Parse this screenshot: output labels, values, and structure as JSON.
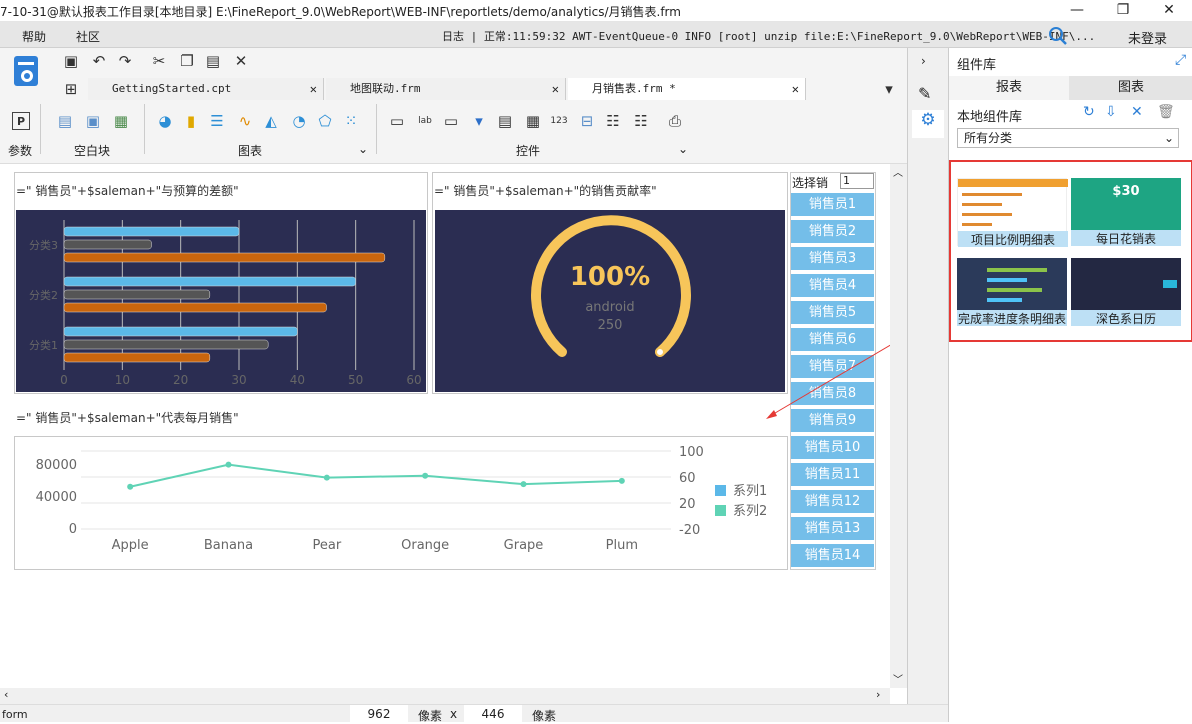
{
  "window": {
    "title": "7-10-31@默认报表工作目录[本地目录]    E:\\FineReport_9.0\\WebReport\\WEB-INF\\reportlets/demo/analytics/月销售表.frm",
    "minimize": "—",
    "maximize": "❐",
    "close": "✕"
  },
  "menu": {
    "items": [
      "帮助",
      "社区"
    ],
    "log_label": "日志",
    "log_text": "正常:11:59:32 AWT-EventQueue-0 INFO [root] unzip file:E:\\FineReport_9.0\\WebReport\\WEB-INF\\...",
    "login": "未登录"
  },
  "tabs": [
    {
      "label": "GettingStarted.cpt",
      "close": "✕"
    },
    {
      "label": "地图联动.frm",
      "close": "✕"
    },
    {
      "label": "月销售表.frm *",
      "close": "✕"
    }
  ],
  "toolbar": {
    "groups": [
      "参数",
      "空白块",
      "图表",
      "控件"
    ],
    "expand": "⌄"
  },
  "canvas": {
    "formula1": "=\"  销售员\"+$saleman+\"与预算的差额\"",
    "formula2": "=\"  销售员\"+$saleman+\"的销售贡献率\"",
    "formula3": "=\"  销售员\"+$saleman+\"代表每月销售\"",
    "selector_label": "选择销",
    "selector_value": "1",
    "salespeople": [
      "销售员1",
      "销售员2",
      "销售员3",
      "销售员4",
      "销售员5",
      "销售员6",
      "销售员7",
      "销售员8",
      "销售员9",
      "销售员10",
      "销售员11",
      "销售员12",
      "销售员13",
      "销售员14"
    ]
  },
  "chart_data": [
    {
      "type": "bar",
      "orientation": "horizontal",
      "categories": [
        "分类1",
        "分类2",
        "分类3"
      ],
      "series": [
        {
          "values": [
            40,
            50,
            30
          ],
          "color": "#5bb8e8"
        },
        {
          "values": [
            35,
            25,
            15
          ],
          "color": "#555555"
        },
        {
          "values": [
            25,
            45,
            55
          ],
          "color": "#c9650d"
        }
      ],
      "xticks": [
        "0",
        "10",
        "20",
        "30",
        "40",
        "50",
        "60"
      ],
      "xlim": [
        0,
        60
      ]
    },
    {
      "type": "gauge",
      "value_text": "100%",
      "label": "android",
      "sublabel": "250",
      "color": "#f7c55a"
    },
    {
      "type": "line",
      "categories": [
        "Apple",
        "Banana",
        "Pear",
        "Orange",
        "Grape",
        "Plum"
      ],
      "yticks_left": [
        "80000",
        "40000",
        "0"
      ],
      "yticks_right": [
        "100",
        "60",
        "20",
        "-20"
      ],
      "series": [
        {
          "name": "系列1",
          "values": [],
          "color": "#5bb8e8"
        },
        {
          "name": "系列2",
          "values": [
            45,
            79,
            59,
            62,
            49,
            54
          ],
          "color": "#5fd3b5"
        }
      ],
      "ylim_right": [
        -20,
        100
      ]
    }
  ],
  "right_panel": {
    "title": "组件库",
    "tabs": [
      "报表",
      "图表"
    ],
    "local_label": "本地组件库",
    "category": "所有分类",
    "components": [
      "项目比例明细表",
      "每日花销表",
      "完成率进度条明细表",
      "深色系日历"
    ]
  },
  "status": {
    "left": "form",
    "width": "962",
    "unit1": "像素",
    "x": "x",
    "height": "446",
    "unit2": "像素"
  },
  "accent": "#e53935"
}
